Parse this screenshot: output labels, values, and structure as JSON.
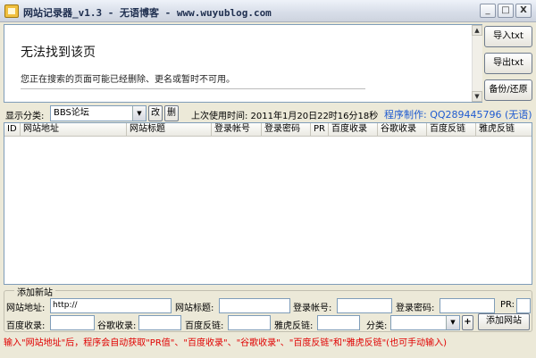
{
  "window": {
    "title": "网站记录器_v1.3 - 无语博客 - www.wuyublog.com",
    "minimize": "_",
    "maximize": "□",
    "close": "X"
  },
  "browser": {
    "error_title": "无法找到该页",
    "error_message": "您正在搜索的页面可能已经删除、更名或暂时不可用。"
  },
  "scrollbar": {
    "up": "▲",
    "down": "▼"
  },
  "side_buttons": {
    "import": "导入txt",
    "export": "导出txt",
    "backup": "备份/还原"
  },
  "filter": {
    "label": "显示分类:",
    "selected": "BBS论坛",
    "arrow": "▼",
    "edit": "改",
    "delete": "删",
    "last_used": "上次使用时间: 2011年1月20日22时16分18秒",
    "author": "程序制作: QQ289445796 (无语)"
  },
  "table": {
    "columns": [
      "ID",
      "网站地址",
      "网站标题",
      "登录帐号",
      "登录密码",
      "PR",
      "百度收录",
      "谷歌收录",
      "百度反链",
      "雅虎反链"
    ],
    "rows": []
  },
  "add_group": {
    "title": "添加新站",
    "url_label": "网站地址:",
    "url_value": "http://",
    "site_title_label": "网站标题:",
    "account_label": "登录帐号:",
    "password_label": "登录密码:",
    "pr_label": "PR:",
    "baidu_index_label": "百度收录:",
    "google_index_label": "谷歌收录:",
    "baidu_backlink_label": "百度反链:",
    "yahoo_backlink_label": "雅虎反链:",
    "category_label": "分类:",
    "category_arrow": "▼",
    "add_category": "+",
    "add_site": "添加网站"
  },
  "hint": "输入\"网站地址\"后，程序会自动获取\"PR值\"、\"百度收录\"、\"谷歌收录\"、\"百度反链\"和\"雅虎反链\"(也可手动输入)"
}
